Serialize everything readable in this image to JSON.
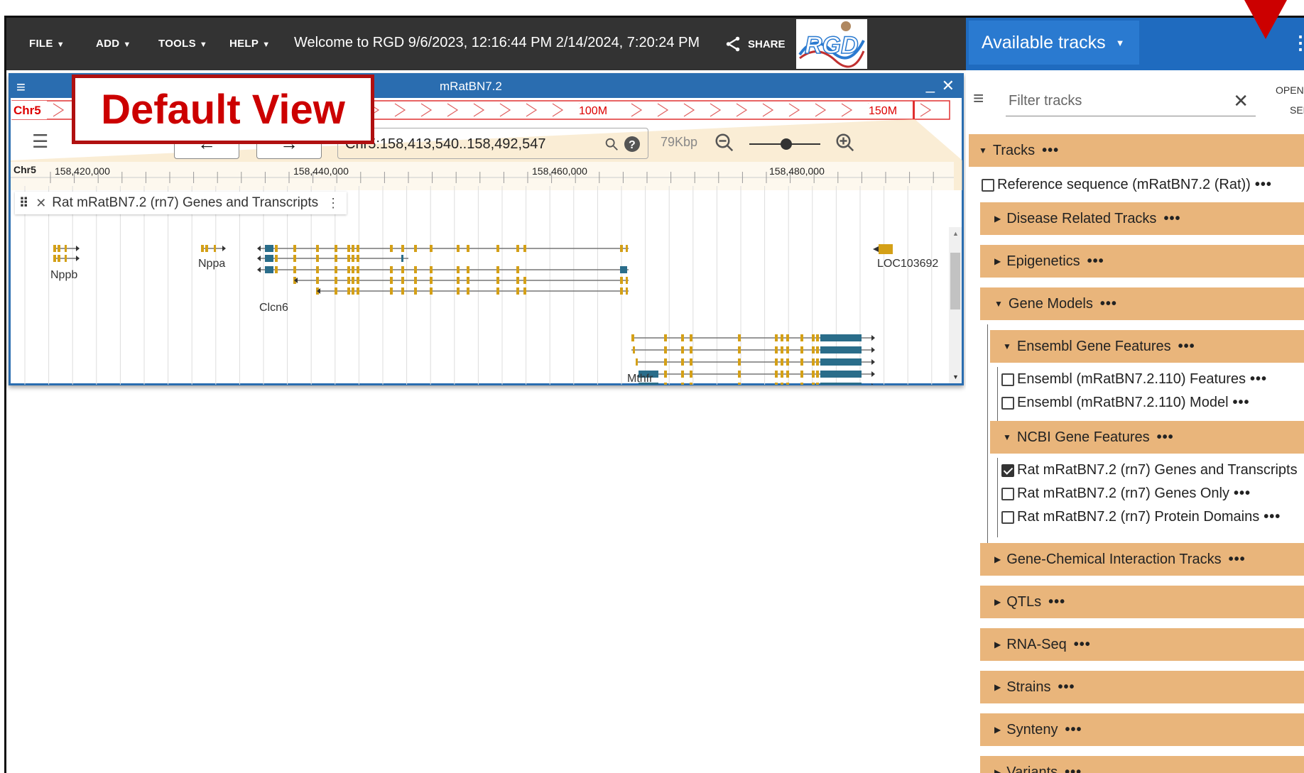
{
  "topbar": {
    "menus": [
      {
        "label": "FILE"
      },
      {
        "label": "ADD"
      },
      {
        "label": "TOOLS"
      },
      {
        "label": "HELP"
      }
    ],
    "welcome": "Welcome to RGD 9/6/2023, 12:16:44 PM 2/14/2024, 7:20:24 PM",
    "share_label": "SHARE",
    "logo_text": "RGD"
  },
  "view": {
    "assembly": "mRatBN7.2",
    "overview": {
      "chrom_label": "Chr5",
      "tick_100": "100M",
      "tick_150": "150M"
    },
    "location": "Chr5:158,413,540..158,492,547",
    "span": "79Kbp",
    "ruler": {
      "chrom": "Chr5",
      "ticks": [
        "158,420,000",
        "158,440,000",
        "158,460,000",
        "158,480,000"
      ]
    },
    "track_name": "Rat mRatBN7.2 (rn7) Genes and Transcripts",
    "genes": [
      "Nppb",
      "Nppa",
      "Clcn6",
      "Mthfr",
      "LOC103692"
    ]
  },
  "callout": "Default View",
  "side": {
    "title": "Available tracks",
    "open_label": "OPEN",
    "sel_label": "SEL",
    "filter_placeholder": "Filter tracks",
    "tracks_heading": "Tracks",
    "reference": "Reference sequence (mRatBN7.2 (Rat))",
    "categories": {
      "disease": "Disease Related Tracks",
      "epigenetics": "Epigenetics",
      "gene_models": "Gene Models",
      "ensembl": "Ensembl Gene Features",
      "ensembl_features": "Ensembl (mRatBN7.2.110) Features",
      "ensembl_model": "Ensembl (mRatBN7.2.110) Model",
      "ncbi": "NCBI Gene Features",
      "ncbi_genes_transcripts": "Rat mRatBN7.2 (rn7) Genes and Transcripts",
      "ncbi_genes_only": "Rat mRatBN7.2 (rn7) Genes Only",
      "ncbi_protein": "Rat mRatBN7.2 (rn7) Protein Domains",
      "chemical": "Gene-Chemical Interaction Tracks",
      "qtls": "QTLs",
      "rnaseq": "RNA-Seq",
      "strains": "Strains",
      "synteny": "Synteny",
      "variants": "Variants"
    },
    "dots": "•••"
  }
}
